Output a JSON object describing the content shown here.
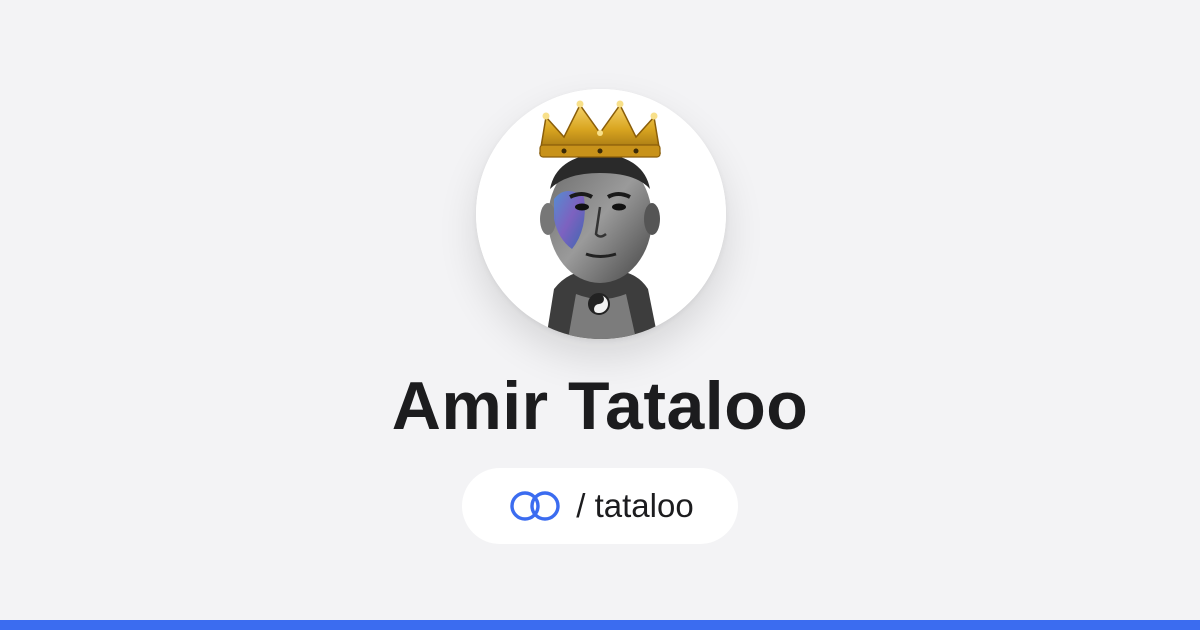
{
  "profile": {
    "display_name": "Amir Tataloo",
    "handle_separator": "/",
    "handle": "tataloo",
    "handle_display": "/ tataloo",
    "avatar_icon": "portrait-with-crown"
  },
  "brand": {
    "logo_icon": "interlinked-rings-icon",
    "accent_color": "#3b6cf0",
    "background_color": "#f3f3f5",
    "bottom_bar_color": "#3b6cf0"
  }
}
